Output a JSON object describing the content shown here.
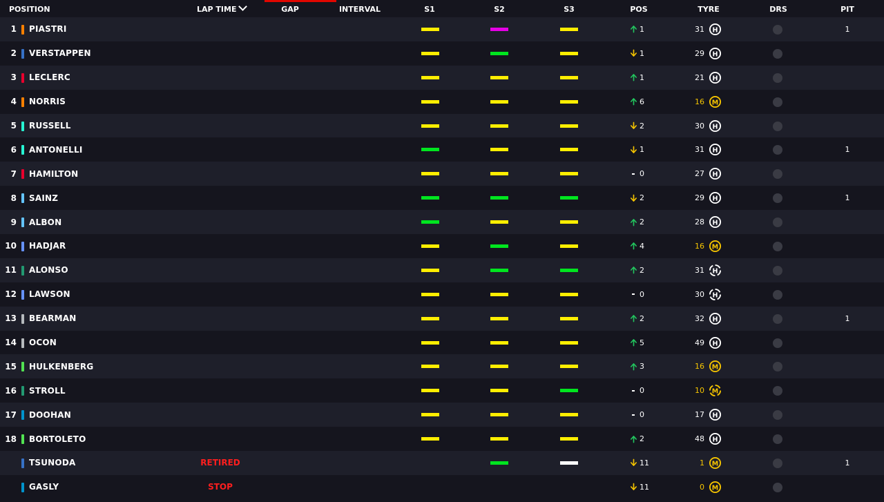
{
  "header": {
    "position": "POSITION",
    "lap_time": "LAP TIME",
    "gap": "GAP",
    "interval": "INTERVAL",
    "s1": "S1",
    "s2": "S2",
    "s3": "S3",
    "pos": "POS",
    "tyre": "TYRE",
    "drs": "DRS",
    "pit": "PIT"
  },
  "colors": {
    "accent": "#e10600",
    "sector_yellow": "#ffee00",
    "sector_green": "#00e51f",
    "sector_purple": "#e600e6",
    "sector_white": "#ffffff",
    "up": "#22c55e",
    "down": "#f5c400",
    "tyre_hard": "#ffffff",
    "tyre_medium": "#f5c400",
    "status_red": "#ff1e1e"
  },
  "rows": [
    {
      "position": "1",
      "driver": "PIASTRI",
      "team_color": "#ff8000",
      "lap_time": "",
      "sectors": [
        "yellow",
        "purple",
        "yellow"
      ],
      "pos_dir": "up",
      "pos_change": "1",
      "tyre_age": "31",
      "tyre": "H",
      "tyre_new": false,
      "pit": "1"
    },
    {
      "position": "2",
      "driver": "VERSTAPPEN",
      "team_color": "#3671c6",
      "lap_time": "",
      "sectors": [
        "yellow",
        "green",
        "yellow"
      ],
      "pos_dir": "down",
      "pos_change": "1",
      "tyre_age": "29",
      "tyre": "H",
      "tyre_new": false,
      "pit": ""
    },
    {
      "position": "3",
      "driver": "LECLERC",
      "team_color": "#e8002d",
      "lap_time": "",
      "sectors": [
        "yellow",
        "yellow",
        "yellow"
      ],
      "pos_dir": "up",
      "pos_change": "1",
      "tyre_age": "21",
      "tyre": "H",
      "tyre_new": false,
      "pit": ""
    },
    {
      "position": "4",
      "driver": "NORRIS",
      "team_color": "#ff8000",
      "lap_time": "",
      "sectors": [
        "yellow",
        "yellow",
        "yellow"
      ],
      "pos_dir": "up",
      "pos_change": "6",
      "tyre_age": "16",
      "tyre": "M",
      "tyre_new": false,
      "pit": ""
    },
    {
      "position": "5",
      "driver": "RUSSELL",
      "team_color": "#27f4d2",
      "lap_time": "",
      "sectors": [
        "yellow",
        "yellow",
        "yellow"
      ],
      "pos_dir": "down",
      "pos_change": "2",
      "tyre_age": "30",
      "tyre": "H",
      "tyre_new": false,
      "pit": ""
    },
    {
      "position": "6",
      "driver": "ANTONELLI",
      "team_color": "#27f4d2",
      "lap_time": "",
      "sectors": [
        "green",
        "yellow",
        "yellow"
      ],
      "pos_dir": "down",
      "pos_change": "1",
      "tyre_age": "31",
      "tyre": "H",
      "tyre_new": false,
      "pit": "1"
    },
    {
      "position": "7",
      "driver": "HAMILTON",
      "team_color": "#e8002d",
      "lap_time": "",
      "sectors": [
        "yellow",
        "yellow",
        "yellow"
      ],
      "pos_dir": "none",
      "pos_change": "0",
      "tyre_age": "27",
      "tyre": "H",
      "tyre_new": false,
      "pit": ""
    },
    {
      "position": "8",
      "driver": "SAINZ",
      "team_color": "#64c4ff",
      "lap_time": "",
      "sectors": [
        "green",
        "green",
        "green"
      ],
      "pos_dir": "down",
      "pos_change": "2",
      "tyre_age": "29",
      "tyre": "H",
      "tyre_new": false,
      "pit": "1"
    },
    {
      "position": "9",
      "driver": "ALBON",
      "team_color": "#64c4ff",
      "lap_time": "",
      "sectors": [
        "green",
        "yellow",
        "yellow"
      ],
      "pos_dir": "up",
      "pos_change": "2",
      "tyre_age": "28",
      "tyre": "H",
      "tyre_new": false,
      "pit": ""
    },
    {
      "position": "10",
      "driver": "HADJAR",
      "team_color": "#6692ff",
      "lap_time": "",
      "sectors": [
        "yellow",
        "green",
        "yellow"
      ],
      "pos_dir": "up",
      "pos_change": "4",
      "tyre_age": "16",
      "tyre": "M",
      "tyre_new": false,
      "pit": ""
    },
    {
      "position": "11",
      "driver": "ALONSO",
      "team_color": "#229971",
      "lap_time": "",
      "sectors": [
        "yellow",
        "green",
        "green"
      ],
      "pos_dir": "up",
      "pos_change": "2",
      "tyre_age": "31",
      "tyre": "H",
      "tyre_new": true,
      "pit": ""
    },
    {
      "position": "12",
      "driver": "LAWSON",
      "team_color": "#6692ff",
      "lap_time": "",
      "sectors": [
        "yellow",
        "yellow",
        "yellow"
      ],
      "pos_dir": "none",
      "pos_change": "0",
      "tyre_age": "30",
      "tyre": "H",
      "tyre_new": true,
      "pit": ""
    },
    {
      "position": "13",
      "driver": "BEARMAN",
      "team_color": "#b6babd",
      "lap_time": "",
      "sectors": [
        "yellow",
        "yellow",
        "yellow"
      ],
      "pos_dir": "up",
      "pos_change": "2",
      "tyre_age": "32",
      "tyre": "H",
      "tyre_new": false,
      "pit": "1"
    },
    {
      "position": "14",
      "driver": "OCON",
      "team_color": "#b6babd",
      "lap_time": "",
      "sectors": [
        "yellow",
        "yellow",
        "yellow"
      ],
      "pos_dir": "up",
      "pos_change": "5",
      "tyre_age": "49",
      "tyre": "H",
      "tyre_new": false,
      "pit": ""
    },
    {
      "position": "15",
      "driver": "HULKENBERG",
      "team_color": "#52e252",
      "lap_time": "",
      "sectors": [
        "yellow",
        "yellow",
        "yellow"
      ],
      "pos_dir": "up",
      "pos_change": "3",
      "tyre_age": "16",
      "tyre": "M",
      "tyre_new": false,
      "pit": ""
    },
    {
      "position": "16",
      "driver": "STROLL",
      "team_color": "#229971",
      "lap_time": "",
      "sectors": [
        "yellow",
        "yellow",
        "green"
      ],
      "pos_dir": "none",
      "pos_change": "0",
      "tyre_age": "10",
      "tyre": "M",
      "tyre_new": true,
      "pit": ""
    },
    {
      "position": "17",
      "driver": "DOOHAN",
      "team_color": "#0093cc",
      "lap_time": "",
      "sectors": [
        "yellow",
        "yellow",
        "yellow"
      ],
      "pos_dir": "none",
      "pos_change": "0",
      "tyre_age": "17",
      "tyre": "H",
      "tyre_new": false,
      "pit": ""
    },
    {
      "position": "18",
      "driver": "BORTOLETO",
      "team_color": "#52e252",
      "lap_time": "",
      "sectors": [
        "yellow",
        "yellow",
        "yellow"
      ],
      "pos_dir": "up",
      "pos_change": "2",
      "tyre_age": "48",
      "tyre": "H",
      "tyre_new": false,
      "pit": ""
    },
    {
      "position": "",
      "driver": "TSUNODA",
      "team_color": "#3671c6",
      "lap_time": "RETIRED",
      "sectors": [
        "",
        "green",
        "white"
      ],
      "pos_dir": "down",
      "pos_change": "11",
      "tyre_age": "1",
      "tyre": "M",
      "tyre_new": false,
      "pit": "1"
    },
    {
      "position": "",
      "driver": "GASLY",
      "team_color": "#0093cc",
      "lap_time": "STOP",
      "sectors": [
        "",
        "",
        ""
      ],
      "pos_dir": "down",
      "pos_change": "11",
      "tyre_age": "0",
      "tyre": "M",
      "tyre_new": false,
      "pit": ""
    }
  ]
}
